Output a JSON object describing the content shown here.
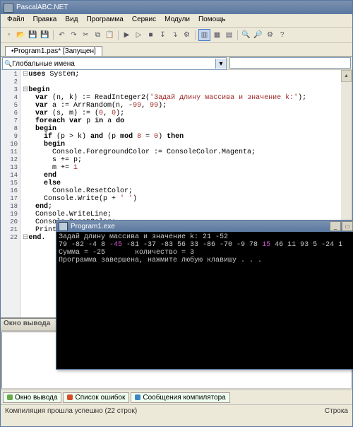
{
  "app_title": "PascalABC.NET",
  "menu": [
    "Файл",
    "Правка",
    "Вид",
    "Программа",
    "Сервис",
    "Модули",
    "Помощь"
  ],
  "toolbar_icons": [
    "new",
    "open",
    "save",
    "saveall",
    "undo",
    "redo",
    "cut",
    "copy",
    "paste",
    "run",
    "runnodbg",
    "stop",
    "stepover",
    "stepinto",
    "build",
    "panel-a",
    "panel-b",
    "panel-c",
    "find",
    "findnext",
    "opts",
    "help"
  ],
  "tab_title": "•Program1.pas* [Запущен]",
  "combo_label": "Глобальные имена",
  "code_lines": [
    "uses System;",
    "",
    "begin",
    "  var (n, k) := ReadInteger2('Задай длину массива и значение k:');",
    "  var a := ArrRandom(n, -99, 99);",
    "  var (s, m) := (0, 0);",
    "  foreach var p in a do",
    "  begin",
    "    if (p > k) and (p mod 8 = 0) then",
    "    begin",
    "      Console.ForegroundColor := ConsoleColor.Magenta;",
    "      s += p;",
    "      m += 1",
    "    end",
    "    else",
    "      Console.ResetColor;",
    "    Console.Write(p + ' ')",
    "  end;",
    "  Console.WriteLine;",
    "  Console.ResetColor;",
    "  Println('Сумма =', s, '   количество =', m)",
    "end."
  ],
  "output_title": "Окно вывода",
  "bottom_tabs": [
    {
      "label": "Окно вывода",
      "color": "#6aa84f"
    },
    {
      "label": "Список ошибок",
      "color": "#d94b2b"
    },
    {
      "label": "Сообщения компилятора",
      "color": "#3d85c6"
    }
  ],
  "status_left": "Компиляция прошла успешно (22 строк)",
  "status_right": "Строка ",
  "console": {
    "title": "Program1.exe",
    "prompt": "Задай длину массива и значение k: 21 -52",
    "nums": [
      "79",
      "-82",
      "-4",
      "8",
      "-45",
      "-81",
      "-37",
      "-83",
      "56",
      "33",
      "-86",
      "-70",
      "-9",
      "78",
      "15",
      "46",
      "11",
      "93",
      "5",
      "-24",
      "1"
    ],
    "highlight_idx": [
      4,
      14
    ],
    "result": "Сумма = -25       количество = 3",
    "done": "Программа завершена, нажмите любую клавишу . . ."
  }
}
